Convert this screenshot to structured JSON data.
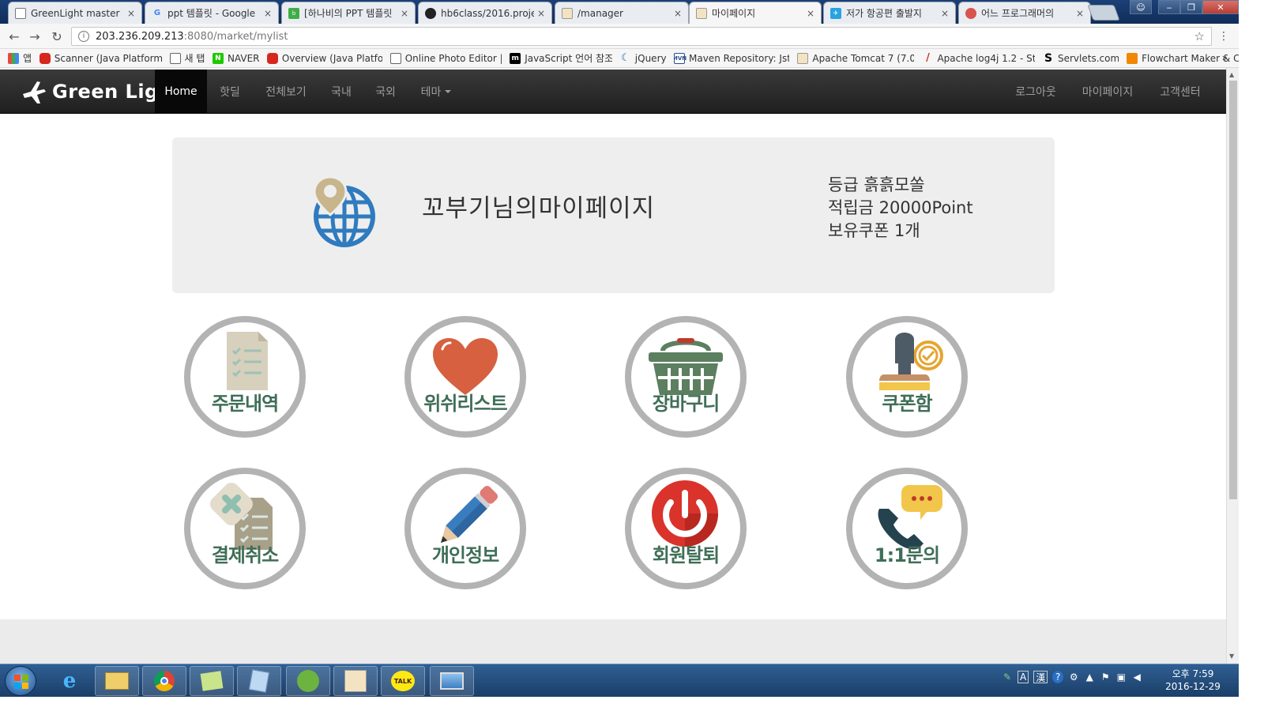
{
  "browser": {
    "tabs": [
      {
        "title": "GreenLight master",
        "icon": "doc-icon",
        "close": "×"
      },
      {
        "title": "ppt 템플릿 - Google",
        "icon": "google-icon",
        "close": "×"
      },
      {
        "title": "[하나비의 PPT 템플릿",
        "icon": "blog-icon",
        "close": "×"
      },
      {
        "title": "hb6class/2016.projec",
        "icon": "github-icon",
        "close": "×"
      },
      {
        "title": "/manager",
        "icon": "tomcat-icon",
        "close": "×"
      },
      {
        "title": "마이페이지",
        "icon": "tomcat-icon",
        "close": "×"
      },
      {
        "title": "저가 항공편 출발지",
        "icon": "flight-icon",
        "close": "×"
      },
      {
        "title": "어느 프로그래머의",
        "icon": "circle-icon",
        "close": "×"
      }
    ],
    "address": {
      "host": "203.236.209.213",
      "path": ":8080/market/mylist"
    },
    "bookmarks": [
      {
        "label": "앱",
        "icon": "apps-icon"
      },
      {
        "label": "Scanner (Java Platform",
        "icon": "oracle-icon"
      },
      {
        "label": "새 탭",
        "icon": "page-icon"
      },
      {
        "label": "NAVER",
        "icon": "naver-icon"
      },
      {
        "label": "Overview (Java Platfo",
        "icon": "oracle-icon"
      },
      {
        "label": "Online Photo Editor |",
        "icon": "page-icon"
      },
      {
        "label": "JavaScript 언어 참조",
        "icon": "mdn-icon"
      },
      {
        "label": "jQuery",
        "icon": "jquery-icon"
      },
      {
        "label": "Maven Repository: Jst",
        "icon": "maven-icon"
      },
      {
        "label": "Apache Tomcat 7 (7.0",
        "icon": "tomcat-icon"
      },
      {
        "label": "Apache log4j 1.2 - St",
        "icon": "feather-icon"
      },
      {
        "label": "Servlets.com",
        "icon": "servlets-icon"
      },
      {
        "label": "Flowchart Maker & C",
        "icon": "flowchart-icon"
      }
    ],
    "bookmarks_more": "»"
  },
  "navbar": {
    "brand": "Green Light",
    "left": [
      "Home",
      "핫딜",
      "전체보기",
      "국내",
      "국외",
      "테마"
    ],
    "right": [
      "로그아웃",
      "마이페이지",
      "고객센터"
    ]
  },
  "jumbotron": {
    "title": "꼬부기님의마이페이지",
    "grade": "등급 흙흙모쏠",
    "points": "적립금 20000Point",
    "coupons": "보유쿠폰 1개"
  },
  "tiles": [
    {
      "label": "주문내역",
      "icon": "order-list-icon"
    },
    {
      "label": "위쉬리스트",
      "icon": "heart-icon"
    },
    {
      "label": "장바구니",
      "icon": "basket-icon"
    },
    {
      "label": "쿠폰함",
      "icon": "stamp-icon"
    },
    {
      "label": "결제취소",
      "icon": "cancel-doc-icon"
    },
    {
      "label": "개인정보",
      "icon": "pencil-icon"
    },
    {
      "label": "회원탈퇴",
      "icon": "power-icon"
    },
    {
      "label": "1:1문의",
      "icon": "phone-chat-icon"
    }
  ],
  "taskbar": {
    "clock_time": "오후 7:59",
    "clock_date": "2016-12-29",
    "tray_ime": "A",
    "tray_ime2": "漢"
  },
  "colors": {
    "navbar": "#222222",
    "jumbotron": "#eeeeee",
    "tile_label": "#3f6e57",
    "tile_border": "#b3b3b3"
  }
}
